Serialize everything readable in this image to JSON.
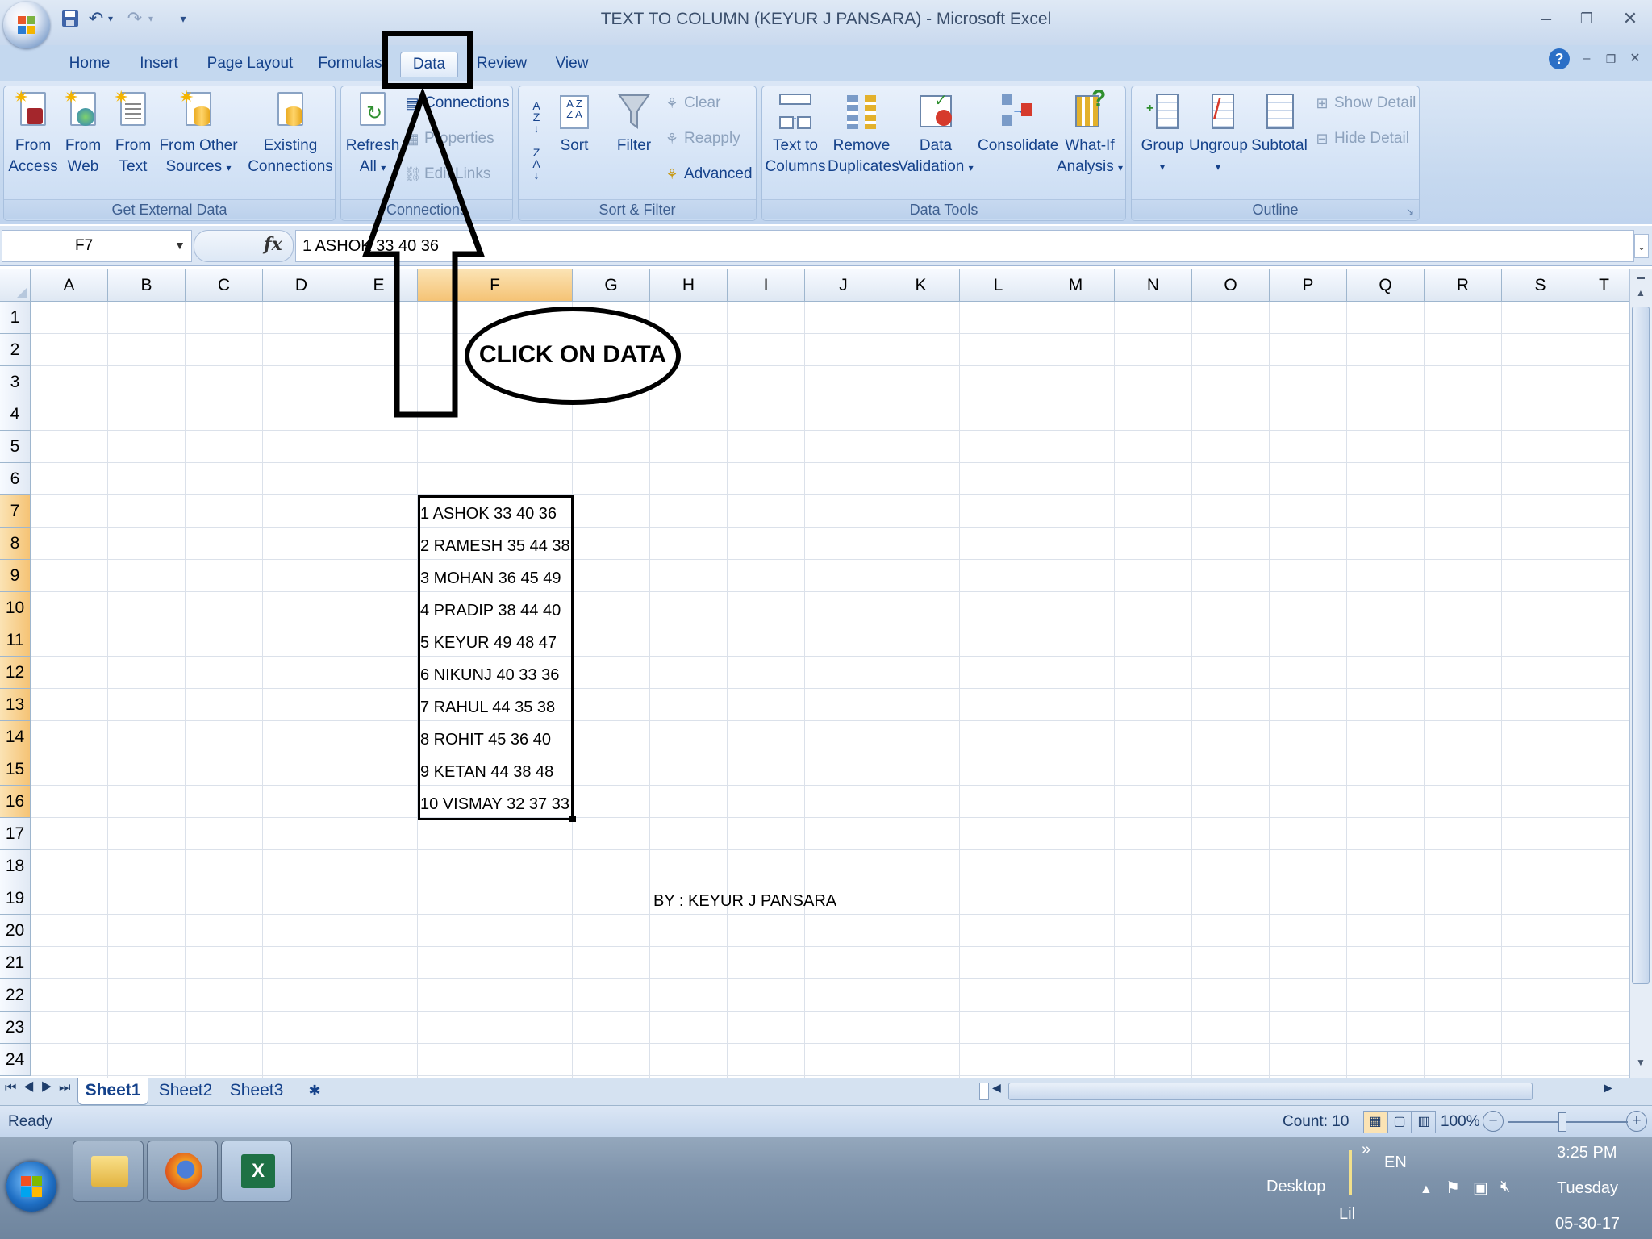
{
  "window": {
    "title": "TEXT TO COLUMN (KEYUR J PANSARA) - Microsoft Excel"
  },
  "quick_access": {
    "icons": [
      "save-icon",
      "undo-icon",
      "redo-icon",
      "customize-icon"
    ]
  },
  "tabs": [
    "Home",
    "Insert",
    "Page Layout",
    "Formulas",
    "Data",
    "Review",
    "View"
  ],
  "active_tab": "Data",
  "ribbon": {
    "get_external_data": {
      "label": "Get External Data",
      "from_access": [
        "From",
        "Access"
      ],
      "from_web": [
        "From",
        "Web"
      ],
      "from_text": [
        "From",
        "Text"
      ],
      "from_other": [
        "From Other",
        "Sources"
      ],
      "existing": [
        "Existing",
        "Connections"
      ]
    },
    "connections": {
      "label": "Connections",
      "refresh": [
        "Refresh",
        "All"
      ],
      "connections": "Connections",
      "properties": "Properties",
      "edit_links": "Edit Links"
    },
    "sort_filter": {
      "label": "Sort & Filter",
      "sort_az": "A↓Z",
      "sort_za": "Z↓A",
      "sort": "Sort",
      "filter": "Filter",
      "clear": "Clear",
      "reapply": "Reapply",
      "advanced": "Advanced"
    },
    "data_tools": {
      "label": "Data Tools",
      "text_to_columns": [
        "Text to",
        "Columns"
      ],
      "remove_duplicates": [
        "Remove",
        "Duplicates"
      ],
      "data_validation": [
        "Data",
        "Validation"
      ],
      "consolidate": "Consolidate",
      "what_if": [
        "What-If",
        "Analysis"
      ]
    },
    "outline": {
      "label": "Outline",
      "group": "Group",
      "ungroup": "Ungroup",
      "subtotal": "Subtotal",
      "show_detail": "Show Detail",
      "hide_detail": "Hide Detail"
    }
  },
  "formula_bar": {
    "name_box": "F7",
    "fx": "fx",
    "content": "1 ASHOK 33 40 36"
  },
  "columns": [
    "A",
    "B",
    "C",
    "D",
    "E",
    "F",
    "G",
    "H",
    "I",
    "J",
    "K",
    "L",
    "M",
    "N",
    "O",
    "P",
    "Q",
    "R",
    "S",
    "T"
  ],
  "rows": [
    "1",
    "2",
    "3",
    "4",
    "5",
    "6",
    "7",
    "8",
    "9",
    "10",
    "11",
    "12",
    "13",
    "14",
    "15",
    "16",
    "17",
    "18",
    "19",
    "20",
    "21",
    "22",
    "23",
    "24"
  ],
  "cells": {
    "F7": "1 ASHOK 33 40 36",
    "F8": "2 RAMESH 35 44 38",
    "F9": "3 MOHAN 36 45 49",
    "F10": "4 PRADIP 38 44 40",
    "F11": "5 KEYUR 49 48 47",
    "F12": "6 NIKUNJ 40 33 36",
    "F13": "7 RAHUL 44 35 38",
    "F14": "8 ROHIT 45 36 40",
    "F15": "9 KETAN 44 38 48",
    "F16": "10 VISMAY 32 37 33",
    "H19": "BY : KEYUR J PANSARA"
  },
  "annotation": {
    "callout": "CLICK ON DATA"
  },
  "sheets": [
    "Sheet1",
    "Sheet2",
    "Sheet3"
  ],
  "active_sheet": "Sheet1",
  "status": {
    "mode": "Ready",
    "count": "Count: 10",
    "zoom": "100%"
  },
  "taskbar": {
    "desktop": "Desktop",
    "lang": "EN",
    "lil": "Lil",
    "time": "3:25 PM",
    "day": "Tuesday",
    "date": "05-30-17"
  }
}
